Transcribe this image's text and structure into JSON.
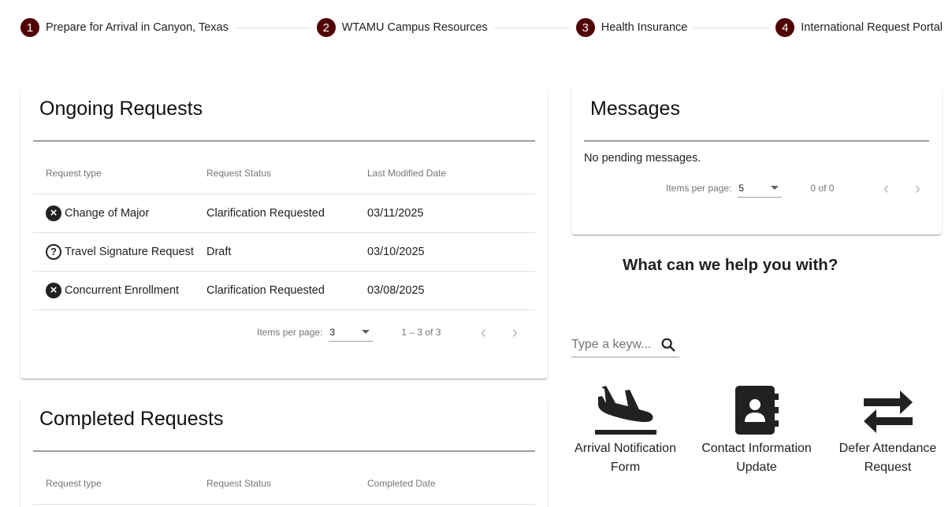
{
  "stepper": {
    "steps": [
      {
        "num": "1",
        "label": "Prepare for Arrival in Canyon, Texas"
      },
      {
        "num": "2",
        "label": "WTAMU Campus Resources"
      },
      {
        "num": "3",
        "label": "Health Insurance"
      },
      {
        "num": "4",
        "label": "International Request Portal"
      }
    ],
    "accent": "#500000"
  },
  "ongoing": {
    "title": "Ongoing Requests",
    "headers": [
      "Request type",
      "Request Status",
      "Last Modified Date"
    ],
    "rows": [
      {
        "icon": "cancel-icon",
        "type": "Change of Major",
        "status": "Clarification Requested",
        "date": "03/11/2025"
      },
      {
        "icon": "help-icon",
        "type": "Travel Signature Request",
        "status": "Draft",
        "date": "03/10/2025"
      },
      {
        "icon": "cancel-icon",
        "type": "Concurrent Enrollment",
        "status": "Clarification Requested",
        "date": "03/08/2025"
      }
    ],
    "paginator": {
      "label": "Items per page:",
      "page_size": "3",
      "range": "1 – 3 of 3"
    }
  },
  "completed": {
    "title": "Completed Requests",
    "headers": [
      "Request type",
      "Request Status",
      "Completed Date"
    ]
  },
  "messages": {
    "title": "Messages",
    "empty_text": "No pending messages.",
    "paginator": {
      "label": "Items per page:",
      "page_size": "5",
      "range": "0 of 0"
    }
  },
  "help": {
    "title": "What can we help you with?",
    "search_placeholder": "Type a keyw...",
    "tiles": [
      {
        "icon": "plane-landing-icon",
        "label": "Arrival Notification Form"
      },
      {
        "icon": "contact-book-icon",
        "label": "Contact Information Update"
      },
      {
        "icon": "swap-arrows-icon",
        "label": "Defer Attendance Request"
      }
    ]
  }
}
